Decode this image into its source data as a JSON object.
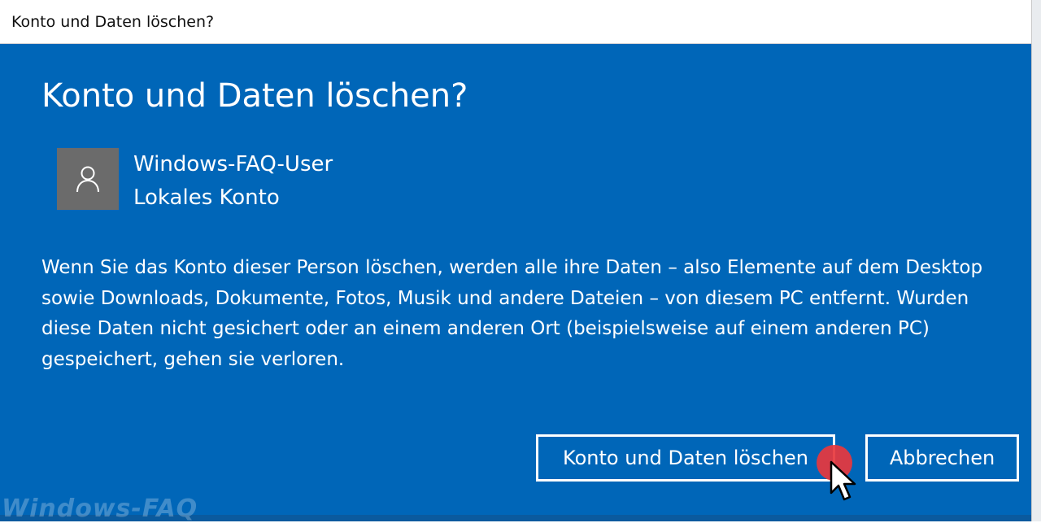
{
  "window": {
    "title": "Konto und Daten löschen?"
  },
  "dialog": {
    "heading": "Konto und Daten löschen?",
    "user": {
      "avatar_icon": "person-icon",
      "name": "Windows-FAQ-User",
      "account_type": "Lokales Konto"
    },
    "message": "Wenn Sie das Konto dieser Person löschen, werden alle ihre Daten – also Elemente auf dem Desktop sowie Downloads, Dokumente, Fotos, Musik und andere Dateien – von diesem PC entfernt. Wurden diese Daten nicht gesichert oder an einem anderen Ort (beispielsweise auf einem anderen PC) gespeichert, gehen sie verloren.",
    "buttons": {
      "delete_label": "Konto und Daten löschen",
      "cancel_label": "Abbrechen"
    }
  },
  "watermark": "Windows-FAQ",
  "colors": {
    "dialog_background": "#0066b8",
    "avatar_background": "#6b6b6b",
    "click_marker": "#e8373d"
  }
}
